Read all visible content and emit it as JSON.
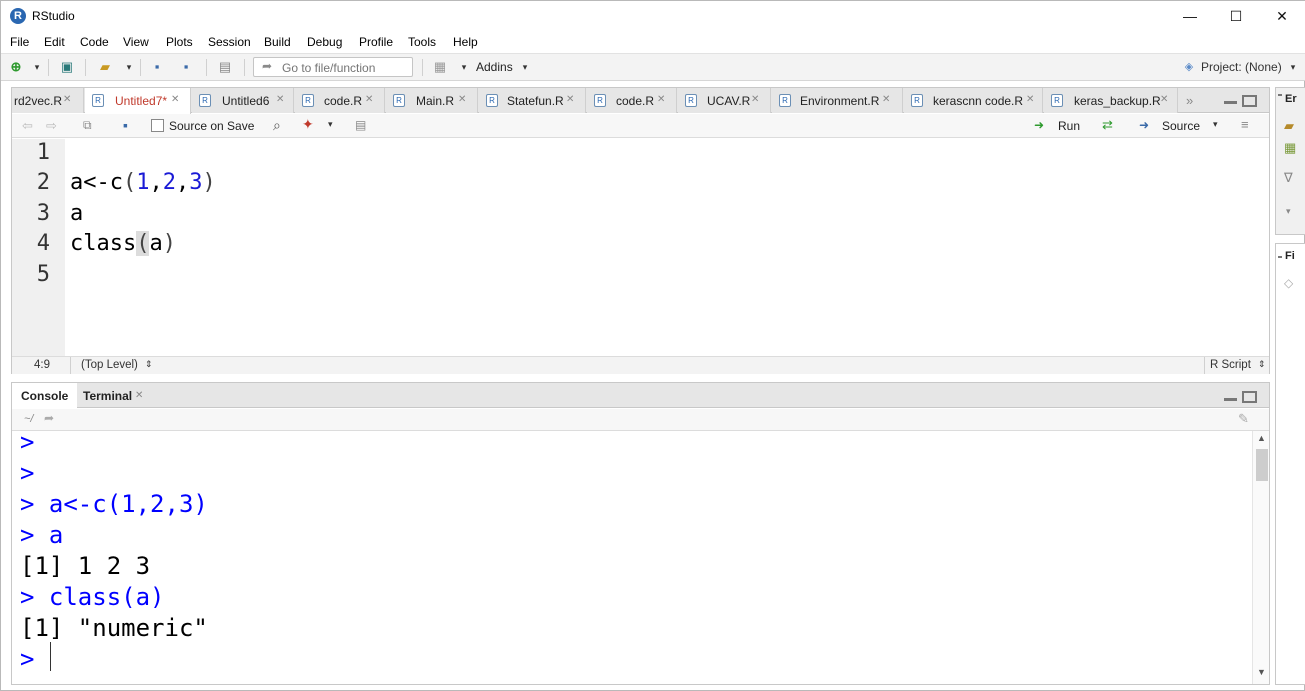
{
  "window": {
    "title": "RStudio",
    "logo_letter": "R",
    "minimize_glyph": "—",
    "maximize_glyph": "☐",
    "close_glyph": "✕"
  },
  "menu": [
    "File",
    "Edit",
    "Code",
    "View",
    "Plots",
    "Session",
    "Build",
    "Debug",
    "Profile",
    "Tools",
    "Help"
  ],
  "toolbar": {
    "goto_placeholder": "Go to file/function",
    "addins_label": "Addins",
    "project_label": "Project: (None)"
  },
  "editor": {
    "tabs": [
      {
        "label": "rd2vec.R"
      },
      {
        "label": "Untitled7*",
        "active": true
      },
      {
        "label": "Untitled6"
      },
      {
        "label": "code.R"
      },
      {
        "label": "Main.R"
      },
      {
        "label": "Statefun.R"
      },
      {
        "label": "code.R"
      },
      {
        "label": "UCAV.R"
      },
      {
        "label": "Environment.R"
      },
      {
        "label": "kerascnn code.R"
      },
      {
        "label": "keras_backup.R"
      }
    ],
    "source_on_save_label": "Source on Save",
    "run_label": "Run",
    "source_label": "Source",
    "line_numbers": [
      "1",
      "2",
      "3",
      "4",
      "5"
    ],
    "lines": {
      "l2_prefix": "a<-c",
      "l2_open": "(",
      "l2_n1": "1",
      "l2_c1": ",",
      "l2_n2": "2",
      "l2_c2": ",",
      "l2_n3": "3",
      "l2_close": ")",
      "l3": "a",
      "l4_prefix": "class",
      "l4_open": "(",
      "l4_arg": "a",
      "l4_close": ")"
    },
    "status": {
      "position": "4:9",
      "scope": "(Top Level)",
      "file_type": "R Script"
    }
  },
  "console": {
    "tabs": [
      "Console",
      "Terminal"
    ],
    "path": "~/",
    "lines": [
      {
        "prompt": ">",
        "text": ""
      },
      {
        "prompt": ">",
        "text": ""
      },
      {
        "prompt": ">",
        "text": " a<-c(1,2,3)"
      },
      {
        "prompt": ">",
        "text": " a"
      },
      {
        "prompt": "",
        "text": "[1] 1 2 3"
      },
      {
        "prompt": ">",
        "text": " class(a)"
      },
      {
        "prompt": "",
        "text": "[1] \"numeric\""
      },
      {
        "prompt": ">",
        "text": ""
      }
    ]
  },
  "right_panes": {
    "top_label": "Er",
    "bottom_label": "Fi"
  }
}
